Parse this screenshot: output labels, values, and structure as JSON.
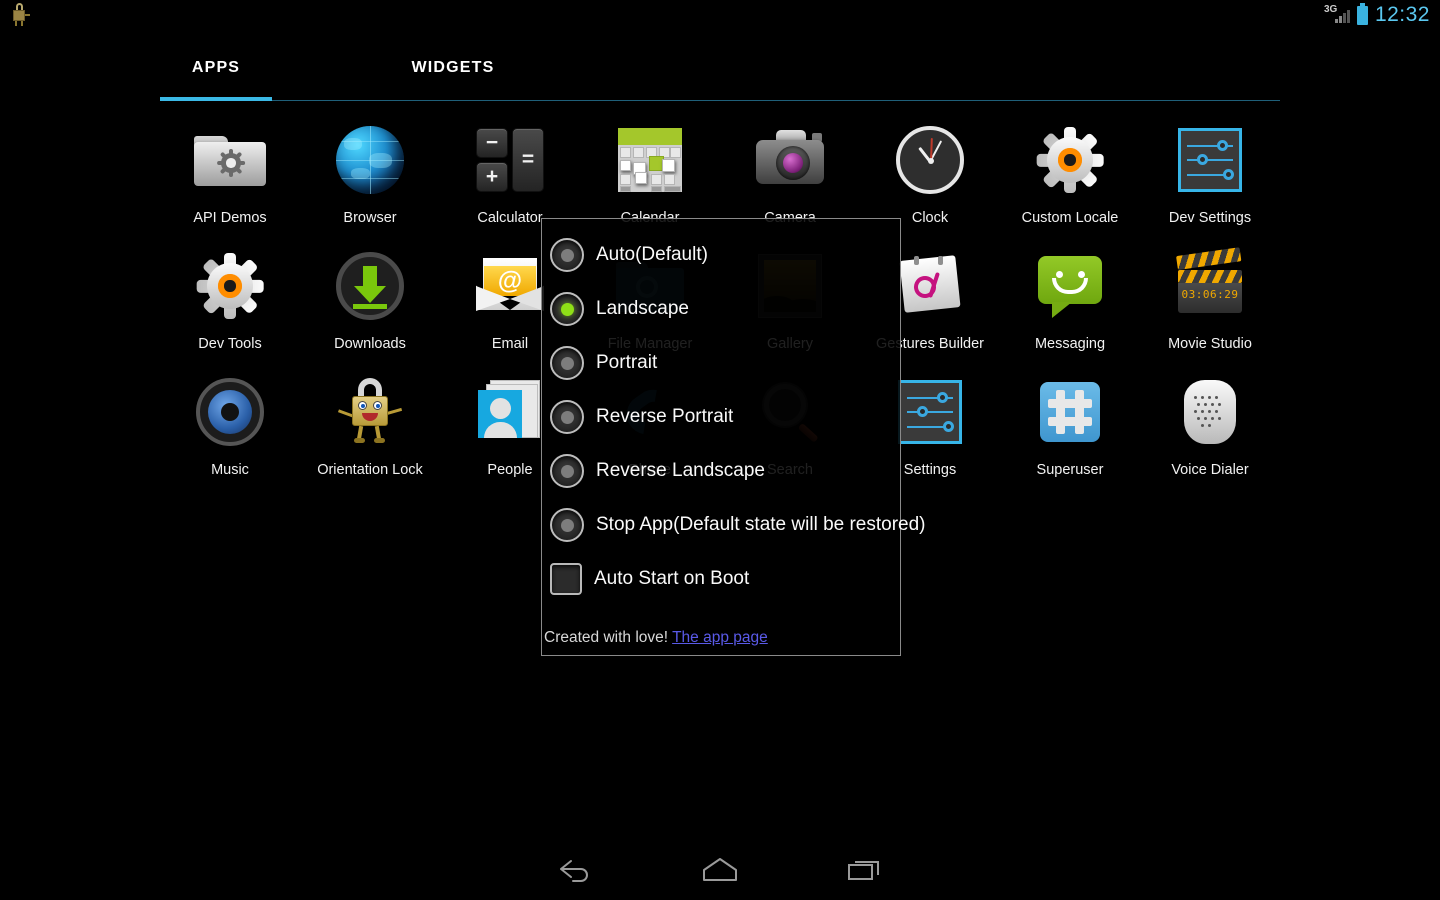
{
  "status_bar": {
    "notification_icon": "orientation-lock-icon",
    "network_label": "3G",
    "signal_icon": "signal-bars-icon",
    "battery_icon": "battery-icon",
    "time": "12:32"
  },
  "tabs": {
    "apps_label": "APPS",
    "widgets_label": "WIDGETS",
    "selected": "APPS",
    "accent_color": "#3bb9e6"
  },
  "apps": [
    {
      "label": "API Demos",
      "icon": "folder-gear-icon"
    },
    {
      "label": "Browser",
      "icon": "globe-icon"
    },
    {
      "label": "Calculator",
      "icon": "calculator-icon",
      "keys": [
        "−",
        "+",
        "="
      ]
    },
    {
      "label": "Calendar",
      "icon": "calendar-icon"
    },
    {
      "label": "Camera",
      "icon": "camera-icon"
    },
    {
      "label": "Clock",
      "icon": "analog-clock-icon"
    },
    {
      "label": "Custom Locale",
      "icon": "gear-orange-icon"
    },
    {
      "label": "Dev Settings",
      "icon": "sliders-icon"
    },
    {
      "label": "Dev Tools",
      "icon": "gear-orange-icon"
    },
    {
      "label": "Downloads",
      "icon": "download-arrow-icon"
    },
    {
      "label": "Email",
      "icon": "envelope-at-icon"
    },
    {
      "label": "File Manager",
      "icon": "folder-search-icon"
    },
    {
      "label": "Gallery",
      "icon": "photo-frame-icon"
    },
    {
      "label": "Gestures Builder",
      "icon": "gesture-pad-icon"
    },
    {
      "label": "Messaging",
      "icon": "speech-bubble-smile-icon"
    },
    {
      "label": "Movie Studio",
      "icon": "clapperboard-icon",
      "timecode": "03:06:29"
    },
    {
      "label": "Music",
      "icon": "speaker-icon"
    },
    {
      "label": "Orientation Lock",
      "icon": "padlock-character-icon"
    },
    {
      "label": "People",
      "icon": "contact-card-icon"
    },
    {
      "label": "Phone",
      "icon": "phone-handset-icon"
    },
    {
      "label": "Search",
      "icon": "magnifier-icon"
    },
    {
      "label": "Settings",
      "icon": "sliders-icon"
    },
    {
      "label": "Superuser",
      "icon": "hash-icon"
    },
    {
      "label": "Voice Dialer",
      "icon": "microphone-icon"
    }
  ],
  "dialog": {
    "options": [
      {
        "label": "Auto(Default)",
        "selected": false
      },
      {
        "label": "Landscape",
        "selected": true
      },
      {
        "label": "Portrait",
        "selected": false
      },
      {
        "label": "Reverse Portrait",
        "selected": false
      },
      {
        "label": "Reverse Landscape",
        "selected": false
      },
      {
        "label": "Stop App(Default state will be restored)",
        "selected": false
      }
    ],
    "checkbox": {
      "label": "Auto Start on Boot",
      "checked": false
    },
    "footer_text": "Created with love!",
    "footer_link": "The app page",
    "link_color": "#5a5ae8",
    "selected_color": "#8fe017"
  },
  "navbar": {
    "back_label": "back-button",
    "home_label": "home-button",
    "recents_label": "recents-button"
  }
}
